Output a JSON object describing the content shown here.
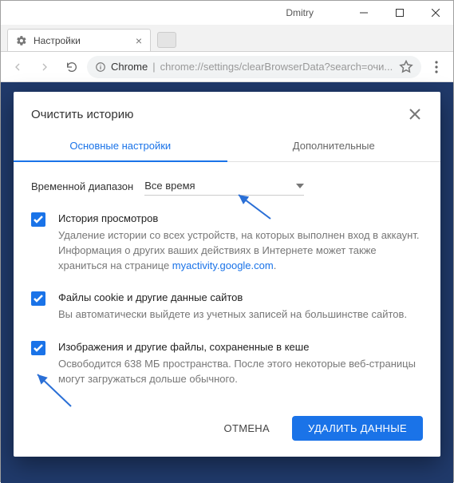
{
  "window": {
    "username": "Dmitry"
  },
  "browser": {
    "tab_title": "Настройки",
    "address_prefix": "Chrome",
    "address_url": "chrome://settings/clearBrowserData?search=очи..."
  },
  "dialog": {
    "title": "Очистить историю",
    "tabs": {
      "basic": "Основные настройки",
      "advanced": "Дополнительные"
    },
    "range_label": "Временной диапазон",
    "range_value": "Все время",
    "options": [
      {
        "title": "История просмотров",
        "desc_pre": "Удаление истории со всех устройств, на которых выполнен вход в аккаунт. Информация о других ваших действиях в Интернете может также храниться на странице ",
        "link": "myactivity.google.com",
        "desc_post": "."
      },
      {
        "title": "Файлы cookie и другие данные сайтов",
        "desc_pre": "Вы автоматически выйдете из учетных записей на большинстве сайтов.",
        "link": "",
        "desc_post": ""
      },
      {
        "title": "Изображения и другие файлы, сохраненные в кеше",
        "desc_pre": "Освободится 638 МБ пространства. После этого некоторые веб-страницы могут загружаться дольше обычного.",
        "link": "",
        "desc_post": ""
      }
    ],
    "buttons": {
      "cancel": "ОТМЕНА",
      "confirm": "УДАЛИТЬ ДАННЫЕ"
    }
  }
}
